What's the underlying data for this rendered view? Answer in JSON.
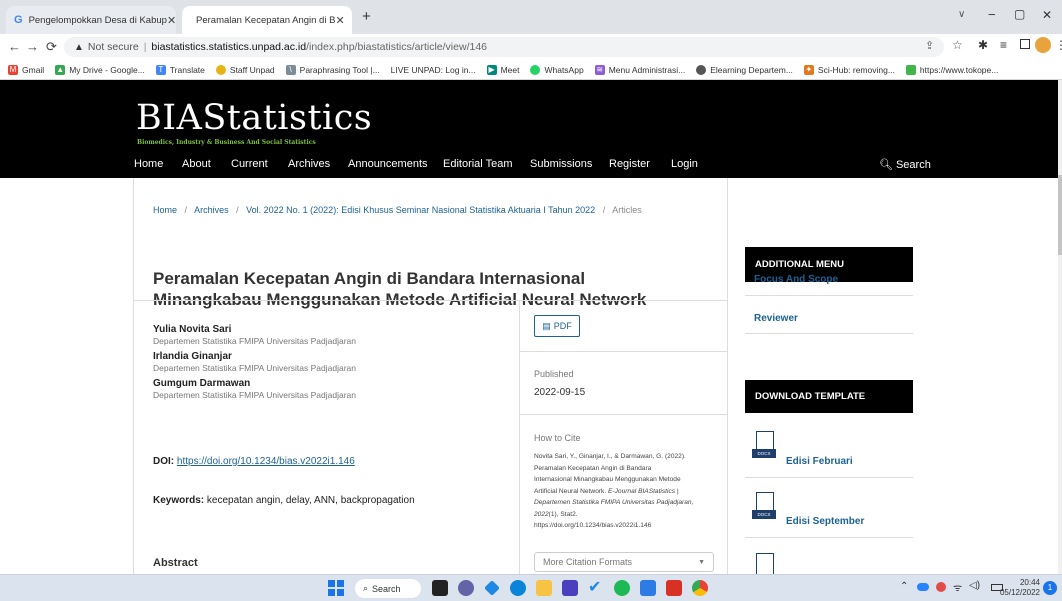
{
  "browser": {
    "tabs": [
      {
        "title": "Pengelompokkan Desa di Kabup",
        "close": "✕"
      },
      {
        "title": "Peramalan Kecepatan Angin di B",
        "close": "✕"
      }
    ],
    "new_tab": "+",
    "security_label": "Not secure",
    "url_host": "biastatistics.statistics.unpad.ac.id",
    "url_path": "/index.php/biastatistics/article/view/146",
    "bookmarks": [
      "Gmail",
      "My Drive - Google...",
      "Translate",
      "Staff Unpad",
      "Paraphrasing Tool |...",
      "LIVE UNPAD: Log in...",
      "Meet",
      "WhatsApp",
      "Menu Administrasi...",
      "Elearning Departem...",
      "Sci-Hub: removing...",
      "https://www.tokope..."
    ],
    "window_controls": {
      "minimize": "−",
      "maximize": "▢",
      "close": "✕",
      "list": "∨"
    }
  },
  "site": {
    "logo": "BIAStatistics",
    "tagline": "Biomedics, Industry & Business And Social Statistics",
    "nav": [
      "Home",
      "About",
      "Current",
      "Archives",
      "Announcements",
      "Editorial Team",
      "Submissions",
      "Register",
      "Login"
    ],
    "search": "Search"
  },
  "breadcrumb": [
    "Home",
    "Archives",
    "Vol. 2022 No. 1 (2022): Edisi Khusus Seminar Nasional Statistika Aktuaria I Tahun 2022",
    "Articles"
  ],
  "breadcrumb_sep": "/",
  "article": {
    "title_line1": "Peramalan Kecepatan Angin di Bandara Internasional",
    "title_line2": "Minangkabau Menggunakan Metode Artificial Neural Network",
    "authors": [
      {
        "name": "Yulia Novita Sari",
        "affiliation": "Departemen Statistika FMIPA Universitas Padjadjaran"
      },
      {
        "name": "Irlandia Ginanjar",
        "affiliation": "Departemen Statistika FMIPA Universitas Padjadjaran"
      },
      {
        "name": "Gumgum Darmawan",
        "affiliation": "Departemen Statistika FMIPA Universitas Padjadjaran"
      }
    ],
    "doi_label": "DOI:",
    "doi": "https://doi.org/10.1234/bias.v2022i1.146",
    "keywords_label": "Keywords:",
    "keywords": "kecepatan angin, delay, ANN, backpropagation",
    "abstract_label": "Abstract",
    "pdf_label": "PDF",
    "published_label": "Published",
    "published_date": "2022-09-15",
    "cite_label": "How to Cite",
    "cite_l1": "Novita Sari, Y., Ginanjar, I., & Darmawan, G. (2022).",
    "cite_l2": "Peramalan Kecepatan Angin di Bandara",
    "cite_l3": "Internasional Minangkabau Menggunakan Metode",
    "cite_l4a": "Artificial Neural Network. ",
    "cite_l4b": "E-Journal BIAStatistics |",
    "cite_l5": "Departemen Statistika FMIPA Universitas Padjadjaran,",
    "cite_l6a": "2022",
    "cite_l6b": "(1), Stat2.",
    "cite_l7": "https://doi.org/10.1234/bias.v2022i1.146",
    "more_formats": "More Citation Formats"
  },
  "sidebar": {
    "additional_menu": "ADDITIONAL MENU",
    "menu_items": [
      "Focus And Scope",
      "Reviewer"
    ],
    "download_template": "DOWNLOAD TEMPLATE",
    "templates": [
      "Edisi Februari",
      "Edisi September"
    ],
    "doc_tag": "DOCX"
  },
  "taskbar": {
    "search": "Search",
    "time": "20:44",
    "date": "05/12/2022",
    "notification_count": "1"
  },
  "colors": {
    "link": "#1e6292",
    "header_bg": "#000000",
    "taskbar_bg": "#dbe3ee"
  }
}
